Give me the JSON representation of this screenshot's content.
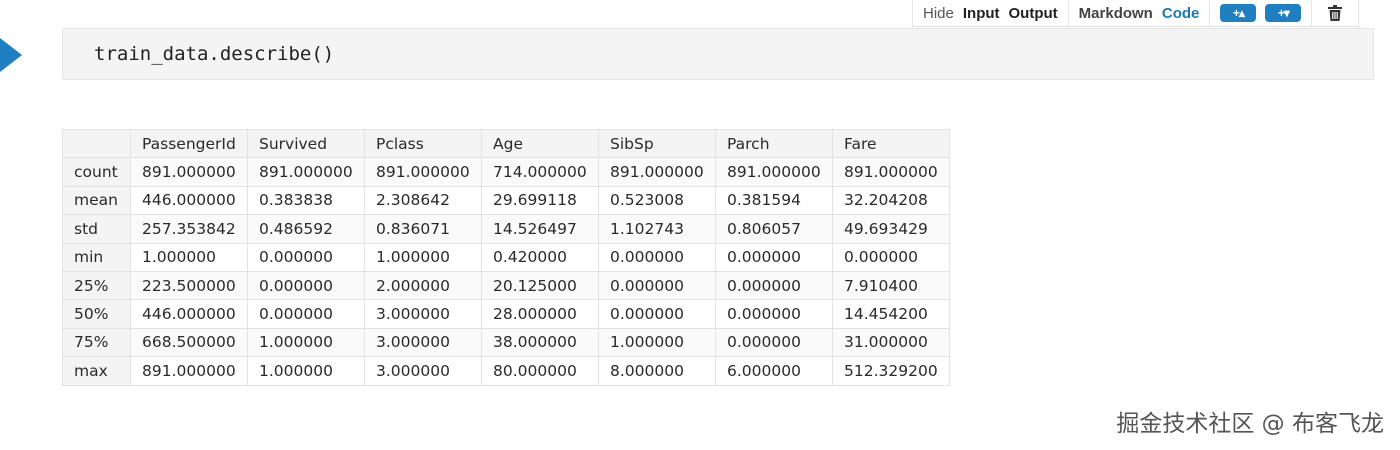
{
  "toolbar": {
    "hide_label": "Hide",
    "input_label": "Input",
    "output_label": "Output",
    "markdown_label": "Markdown",
    "code_label": "Code",
    "add_above_label": "+▴",
    "add_below_label": "+▾",
    "delete_icon": "trash-icon",
    "accent_color": "#1f7fc0"
  },
  "cell": {
    "code": "train_data.describe()"
  },
  "output": {
    "columns": [
      "",
      "PassengerId",
      "Survived",
      "Pclass",
      "Age",
      "SibSp",
      "Parch",
      "Fare"
    ],
    "rows": [
      {
        "label": "count",
        "values": [
          "891.000000",
          "891.000000",
          "891.000000",
          "714.000000",
          "891.000000",
          "891.000000",
          "891.000000"
        ]
      },
      {
        "label": "mean",
        "values": [
          "446.000000",
          "0.383838",
          "2.308642",
          "29.699118",
          "0.523008",
          "0.381594",
          "32.204208"
        ]
      },
      {
        "label": "std",
        "values": [
          "257.353842",
          "0.486592",
          "0.836071",
          "14.526497",
          "1.102743",
          "0.806057",
          "49.693429"
        ]
      },
      {
        "label": "min",
        "values": [
          "1.000000",
          "0.000000",
          "1.000000",
          "0.420000",
          "0.000000",
          "0.000000",
          "0.000000"
        ]
      },
      {
        "label": "25%",
        "values": [
          "223.500000",
          "0.000000",
          "2.000000",
          "20.125000",
          "0.000000",
          "0.000000",
          "7.910400"
        ]
      },
      {
        "label": "50%",
        "values": [
          "446.000000",
          "0.000000",
          "3.000000",
          "28.000000",
          "0.000000",
          "0.000000",
          "14.454200"
        ]
      },
      {
        "label": "75%",
        "values": [
          "668.500000",
          "1.000000",
          "3.000000",
          "38.000000",
          "1.000000",
          "0.000000",
          "31.000000"
        ]
      },
      {
        "label": "max",
        "values": [
          "891.000000",
          "1.000000",
          "3.000000",
          "80.000000",
          "8.000000",
          "6.000000",
          "512.329200"
        ]
      }
    ]
  },
  "watermark": "掘金技术社区 @ 布客飞龙"
}
